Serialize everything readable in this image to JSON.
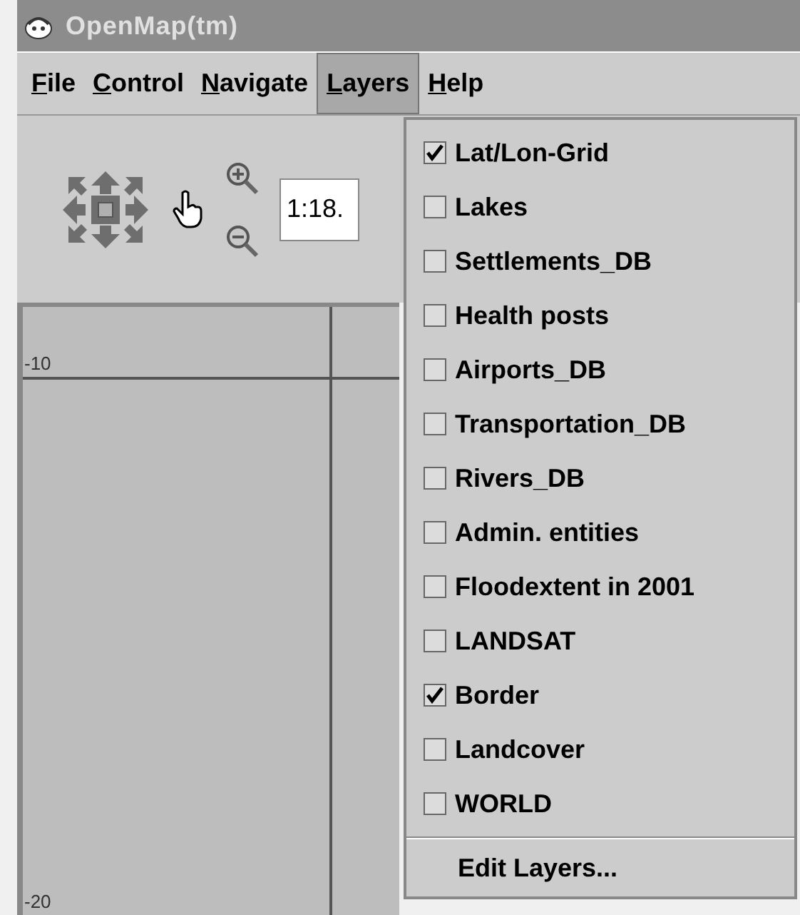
{
  "window": {
    "title": "OpenMap(tm)"
  },
  "menu_bar": [
    {
      "label": "File",
      "selected": false
    },
    {
      "label": "Control",
      "selected": false
    },
    {
      "label": "Navigate",
      "selected": false
    },
    {
      "label": "Layers",
      "selected": true
    },
    {
      "label": "Help",
      "selected": false
    }
  ],
  "toolbar": {
    "scale_field": {
      "value": "1:18."
    }
  },
  "map": {
    "grid_labels": [
      "-10",
      "-20"
    ]
  },
  "layers_menu": {
    "items": [
      {
        "label": "Lat/Lon-Grid",
        "checked": true
      },
      {
        "label": "Lakes",
        "checked": false
      },
      {
        "label": "Settlements_DB",
        "checked": false
      },
      {
        "label": "Health posts",
        "checked": false
      },
      {
        "label": "Airports_DB",
        "checked": false
      },
      {
        "label": "Transportation_DB",
        "checked": false
      },
      {
        "label": "Rivers_DB",
        "checked": false
      },
      {
        "label": "Admin. entities",
        "checked": false
      },
      {
        "label": "Floodextent in 2001",
        "checked": false
      },
      {
        "label": "LANDSAT",
        "checked": false
      },
      {
        "label": "Border",
        "checked": true
      },
      {
        "label": "Landcover",
        "checked": false
      },
      {
        "label": "WORLD",
        "checked": false
      }
    ],
    "footer_item": "Edit Layers..."
  }
}
